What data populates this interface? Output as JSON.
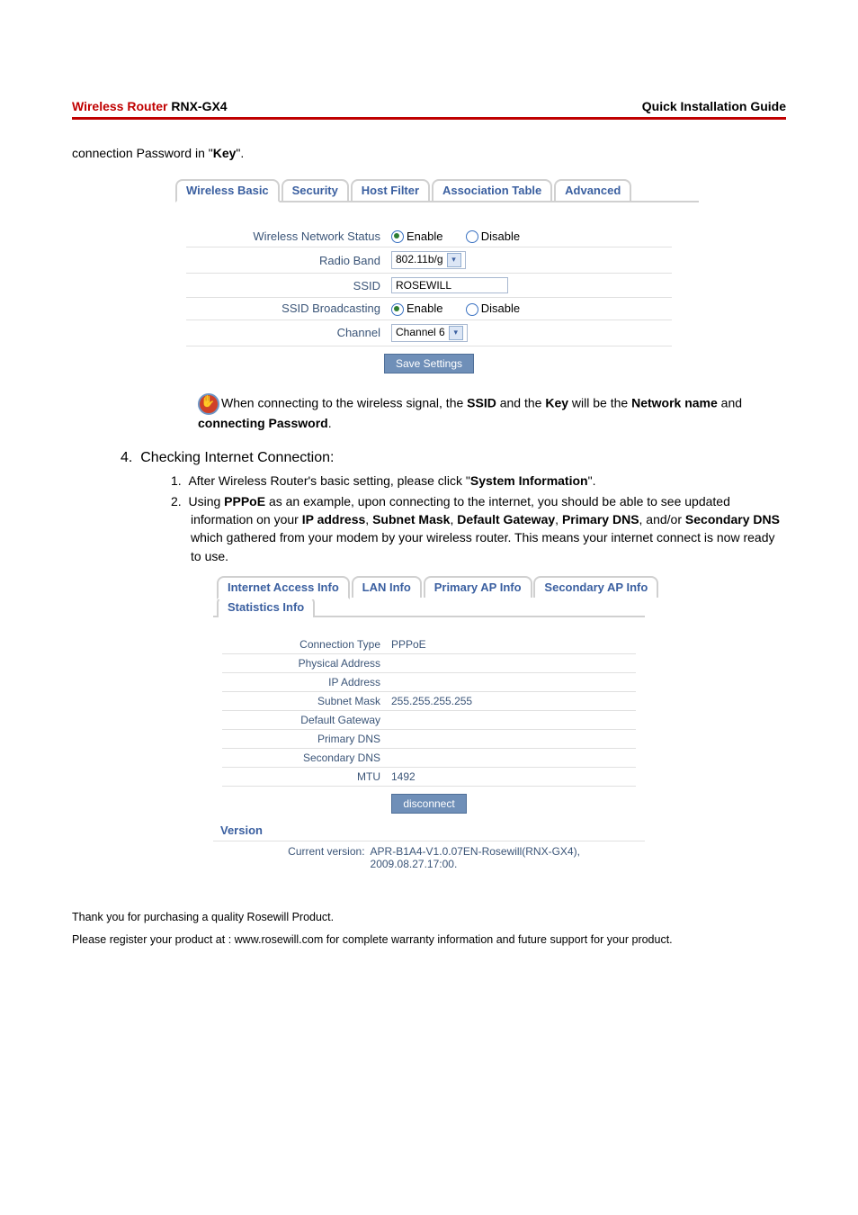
{
  "header": {
    "left_red": "Wireless Router",
    "left_black": " RNX-GX4",
    "right": "Quick Installation Guide"
  },
  "intro_line_prefix": "connection Password in \"",
  "intro_line_bold": "Key",
  "intro_line_suffix": "\".",
  "shot1": {
    "tabs": [
      "Wireless Basic",
      "Security",
      "Host Filter",
      "Association Table",
      "Advanced"
    ],
    "rows": {
      "wns_label": "Wireless Network Status",
      "enable": "Enable",
      "disable": "Disable",
      "radio_band_label": "Radio Band",
      "radio_band_value": "802.11b/g",
      "ssid_label": "SSID",
      "ssid_value": "ROSEWILL",
      "ssid_bc_label": "SSID Broadcasting",
      "channel_label": "Channel",
      "channel_value": "Channel 6"
    },
    "save_btn": "Save Settings"
  },
  "note": {
    "pre": "When connecting to the wireless signal, the ",
    "ssid": "SSID",
    "mid1": " and the ",
    "key": "Key",
    "mid2": " will be the ",
    "netname": "Network name",
    "mid3": " and ",
    "connpw": "connecting Password",
    "end": "."
  },
  "step4": {
    "num": "4.",
    "title": "Checking Internet Connection:",
    "sub1_num": "1.",
    "sub1_a": "After Wireless Router's basic setting, please click \"",
    "sub1_bold": "System Information",
    "sub1_b": "\".",
    "sub2_num": "2.",
    "sub2_a": "Using ",
    "sub2_pppoe": "PPPoE",
    "sub2_b": " as an example, upon connecting to the internet, you should be able to see updated information on your ",
    "sub2_ip": "IP address",
    "sub2_c": ", ",
    "sub2_sm": "Subnet Mask",
    "sub2_d": ", ",
    "sub2_dg": "Default Gateway",
    "sub2_e": ", ",
    "sub2_pd": "Primary DNS",
    "sub2_f": ", and/or ",
    "sub2_sd": "Secondary DNS",
    "sub2_g": " which gathered from your modem by your wireless router. This means your internet connect is now ready to use."
  },
  "shot2": {
    "tabs_row1": [
      "Internet Access Info",
      "LAN Info",
      "Primary AP Info",
      "Secondary AP Info"
    ],
    "tabs_row2": [
      "Statistics Info"
    ],
    "fields": {
      "conn_type_l": "Connection Type",
      "conn_type_v": "PPPoE",
      "phys_l": "Physical Address",
      "ip_l": "IP Address",
      "subnet_l": "Subnet Mask",
      "subnet_v": "255.255.255.255",
      "gw_l": "Default Gateway",
      "pdns_l": "Primary DNS",
      "sdns_l": "Secondary DNS",
      "mtu_l": "MTU",
      "mtu_v": "1492"
    },
    "disconnect_btn": "disconnect",
    "version_heading": "Version",
    "version_label": "Current version:",
    "version_value": "APR-B1A4-V1.0.07EN-Rosewill(RNX-GX4), 2009.08.27.17:00."
  },
  "footer": {
    "l1": "Thank you for purchasing a quality Rosewill Product.",
    "l2": "Please register your product at : www.rosewill.com for complete warranty information and future support for your product."
  }
}
